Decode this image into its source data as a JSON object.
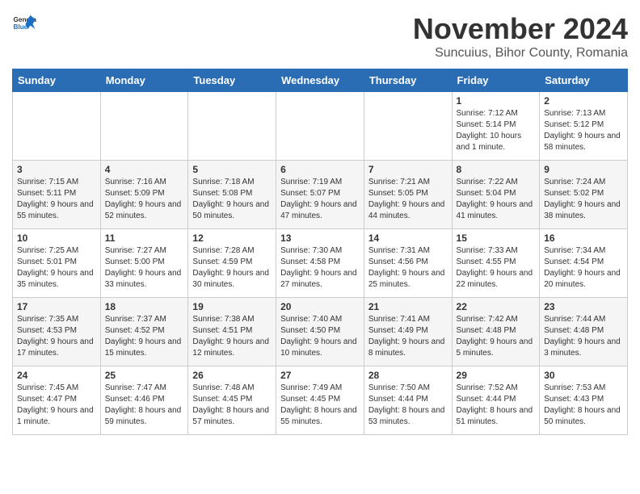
{
  "app": {
    "name_general": "General",
    "name_blue": "Blue"
  },
  "header": {
    "month_title": "November 2024",
    "subtitle": "Suncuius, Bihor County, Romania"
  },
  "calendar": {
    "weekdays": [
      "Sunday",
      "Monday",
      "Tuesday",
      "Wednesday",
      "Thursday",
      "Friday",
      "Saturday"
    ],
    "weeks": [
      [
        {
          "day": "",
          "info": ""
        },
        {
          "day": "",
          "info": ""
        },
        {
          "day": "",
          "info": ""
        },
        {
          "day": "",
          "info": ""
        },
        {
          "day": "",
          "info": ""
        },
        {
          "day": "1",
          "info": "Sunrise: 7:12 AM\nSunset: 5:14 PM\nDaylight: 10 hours and 1 minute."
        },
        {
          "day": "2",
          "info": "Sunrise: 7:13 AM\nSunset: 5:12 PM\nDaylight: 9 hours and 58 minutes."
        }
      ],
      [
        {
          "day": "3",
          "info": "Sunrise: 7:15 AM\nSunset: 5:11 PM\nDaylight: 9 hours and 55 minutes."
        },
        {
          "day": "4",
          "info": "Sunrise: 7:16 AM\nSunset: 5:09 PM\nDaylight: 9 hours and 52 minutes."
        },
        {
          "day": "5",
          "info": "Sunrise: 7:18 AM\nSunset: 5:08 PM\nDaylight: 9 hours and 50 minutes."
        },
        {
          "day": "6",
          "info": "Sunrise: 7:19 AM\nSunset: 5:07 PM\nDaylight: 9 hours and 47 minutes."
        },
        {
          "day": "7",
          "info": "Sunrise: 7:21 AM\nSunset: 5:05 PM\nDaylight: 9 hours and 44 minutes."
        },
        {
          "day": "8",
          "info": "Sunrise: 7:22 AM\nSunset: 5:04 PM\nDaylight: 9 hours and 41 minutes."
        },
        {
          "day": "9",
          "info": "Sunrise: 7:24 AM\nSunset: 5:02 PM\nDaylight: 9 hours and 38 minutes."
        }
      ],
      [
        {
          "day": "10",
          "info": "Sunrise: 7:25 AM\nSunset: 5:01 PM\nDaylight: 9 hours and 35 minutes."
        },
        {
          "day": "11",
          "info": "Sunrise: 7:27 AM\nSunset: 5:00 PM\nDaylight: 9 hours and 33 minutes."
        },
        {
          "day": "12",
          "info": "Sunrise: 7:28 AM\nSunset: 4:59 PM\nDaylight: 9 hours and 30 minutes."
        },
        {
          "day": "13",
          "info": "Sunrise: 7:30 AM\nSunset: 4:58 PM\nDaylight: 9 hours and 27 minutes."
        },
        {
          "day": "14",
          "info": "Sunrise: 7:31 AM\nSunset: 4:56 PM\nDaylight: 9 hours and 25 minutes."
        },
        {
          "day": "15",
          "info": "Sunrise: 7:33 AM\nSunset: 4:55 PM\nDaylight: 9 hours and 22 minutes."
        },
        {
          "day": "16",
          "info": "Sunrise: 7:34 AM\nSunset: 4:54 PM\nDaylight: 9 hours and 20 minutes."
        }
      ],
      [
        {
          "day": "17",
          "info": "Sunrise: 7:35 AM\nSunset: 4:53 PM\nDaylight: 9 hours and 17 minutes."
        },
        {
          "day": "18",
          "info": "Sunrise: 7:37 AM\nSunset: 4:52 PM\nDaylight: 9 hours and 15 minutes."
        },
        {
          "day": "19",
          "info": "Sunrise: 7:38 AM\nSunset: 4:51 PM\nDaylight: 9 hours and 12 minutes."
        },
        {
          "day": "20",
          "info": "Sunrise: 7:40 AM\nSunset: 4:50 PM\nDaylight: 9 hours and 10 minutes."
        },
        {
          "day": "21",
          "info": "Sunrise: 7:41 AM\nSunset: 4:49 PM\nDaylight: 9 hours and 8 minutes."
        },
        {
          "day": "22",
          "info": "Sunrise: 7:42 AM\nSunset: 4:48 PM\nDaylight: 9 hours and 5 minutes."
        },
        {
          "day": "23",
          "info": "Sunrise: 7:44 AM\nSunset: 4:48 PM\nDaylight: 9 hours and 3 minutes."
        }
      ],
      [
        {
          "day": "24",
          "info": "Sunrise: 7:45 AM\nSunset: 4:47 PM\nDaylight: 9 hours and 1 minute."
        },
        {
          "day": "25",
          "info": "Sunrise: 7:47 AM\nSunset: 4:46 PM\nDaylight: 8 hours and 59 minutes."
        },
        {
          "day": "26",
          "info": "Sunrise: 7:48 AM\nSunset: 4:45 PM\nDaylight: 8 hours and 57 minutes."
        },
        {
          "day": "27",
          "info": "Sunrise: 7:49 AM\nSunset: 4:45 PM\nDaylight: 8 hours and 55 minutes."
        },
        {
          "day": "28",
          "info": "Sunrise: 7:50 AM\nSunset: 4:44 PM\nDaylight: 8 hours and 53 minutes."
        },
        {
          "day": "29",
          "info": "Sunrise: 7:52 AM\nSunset: 4:44 PM\nDaylight: 8 hours and 51 minutes."
        },
        {
          "day": "30",
          "info": "Sunrise: 7:53 AM\nSunset: 4:43 PM\nDaylight: 8 hours and 50 minutes."
        }
      ]
    ]
  }
}
